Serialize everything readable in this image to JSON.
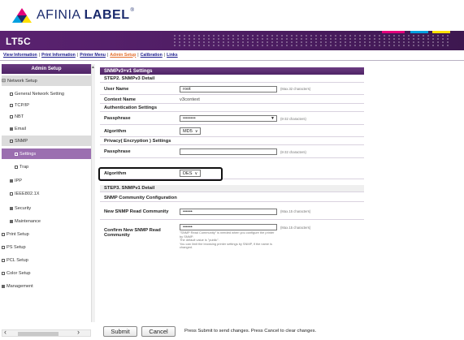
{
  "logo": {
    "brand_prefix": "AFINIA",
    "brand_suffix": "LABEL",
    "tm": "®"
  },
  "header": {
    "title": "LT5C"
  },
  "nav": {
    "links": [
      "View Information",
      "Print Information",
      "Printer Menu",
      "Admin Setup",
      "Calibration",
      "Links"
    ],
    "active": "Admin Setup"
  },
  "sidebar": {
    "title": "Admin Setup",
    "items": [
      {
        "label": "Network Setup",
        "type": "group"
      },
      {
        "label": "General Network Setting"
      },
      {
        "label": "TCP/IP"
      },
      {
        "label": "NBT"
      },
      {
        "label": "Email"
      },
      {
        "label": "SNMP",
        "type": "sub"
      },
      {
        "label": "Settings",
        "type": "active"
      },
      {
        "label": "Trap"
      },
      {
        "label": "IPP"
      },
      {
        "label": "IEEE802.1X"
      },
      {
        "label": "Security"
      },
      {
        "label": "Maintenance"
      },
      {
        "label": "Print Setup"
      },
      {
        "label": "PS Setup"
      },
      {
        "label": "PCL Setup"
      },
      {
        "label": "Color Setup"
      },
      {
        "label": "Management"
      }
    ]
  },
  "panel": {
    "title": "SNMPv3+v1 Settings",
    "step2": "STEP2.  SNMPv3 Detail",
    "user_name": {
      "label": "User Name",
      "value": "root",
      "hint": "(Max.32 characters)"
    },
    "context_name": {
      "label": "Context Name",
      "value": "v3context"
    },
    "auth_settings": "Authentication Settings",
    "passphrase1": {
      "label": "Passphrase",
      "value": "••••••••",
      "hint": "(8-32 characters)"
    },
    "algorithm1": {
      "label": "Algorithm",
      "value": "MD5"
    },
    "privacy_settings": "Privacy( Encryption ) Settings",
    "passphrase2": {
      "label": "Passphrase",
      "value": "",
      "hint": "(8-32 characters)"
    },
    "algorithm2": {
      "label": "Algorithm",
      "value": "DES"
    },
    "step3": "STEP3.  SNMPv1 Detail",
    "community_config": "SNMP Community Configuration",
    "new_read": {
      "label": "New SNMP Read Community",
      "value": "••••••",
      "hint": "(Max.15 characters)"
    },
    "confirm_read": {
      "label": "Confirm New SNMP Read Community",
      "value": "••••••",
      "hint": "(Max.15 characters)",
      "note": "\"SNMP Read Community\" is needed when you configure the printer by SNMP.\nThe default value is \"public\".\nYou can limit the browsing printer settings by SNMP, if the name is changed."
    }
  },
  "footer": {
    "submit": "Submit",
    "cancel": "Cancel",
    "message": "Press Submit to send changes. Press Cancel to clear changes."
  },
  "colors": {
    "header": "#4b1c60",
    "panel_head": "#5a2d70",
    "highlight": "#9b6fb0",
    "active_link": "#e26c2a"
  }
}
